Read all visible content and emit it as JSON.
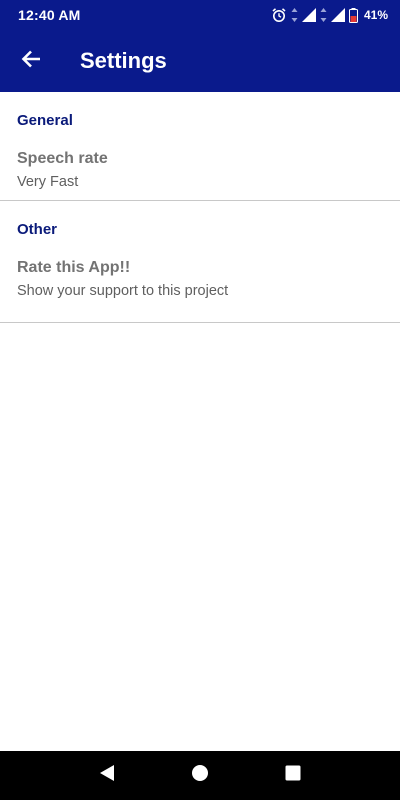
{
  "status_bar": {
    "time": "12:40 AM",
    "battery_percent": "41%",
    "icons": [
      "alarm-icon",
      "data-arrows-icon",
      "signal-icon",
      "data-arrows-icon",
      "signal-icon",
      "battery-icon"
    ]
  },
  "app_bar": {
    "back_icon": "arrow-left-icon",
    "title": "Settings"
  },
  "settings": {
    "categories": [
      {
        "title": "General",
        "items": [
          {
            "title": "Speech rate",
            "summary": "Very Fast"
          }
        ]
      },
      {
        "title": "Other",
        "items": [
          {
            "title": "Rate this App!!",
            "summary": "Show your support to this project"
          }
        ]
      }
    ]
  },
  "nav_bar": {
    "icons": [
      "back-triangle-icon",
      "home-circle-icon",
      "recents-square-icon"
    ]
  },
  "colors": {
    "primary": "#0a1a8c",
    "category_title": "#0a1a7a",
    "item_title": "#737373",
    "item_summary": "#5f5f5f",
    "divider": "#c8c8c8"
  }
}
